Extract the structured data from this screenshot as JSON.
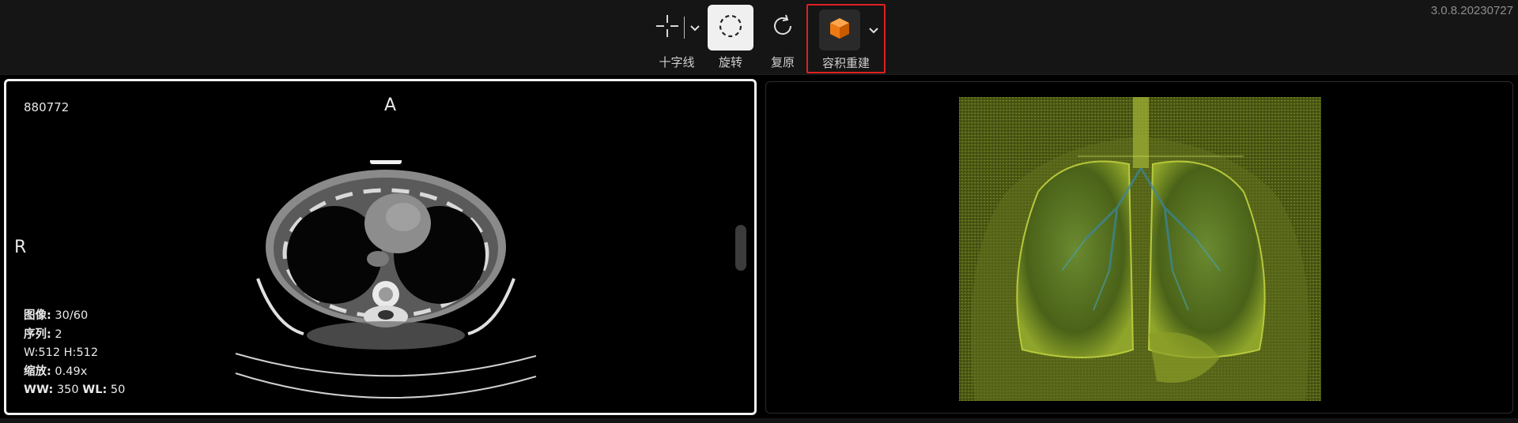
{
  "app": {
    "version": "3.0.8.20230727"
  },
  "toolbar": {
    "tools": [
      {
        "id": "crosshair",
        "label": "十字线",
        "icon": "crosshair-icon"
      },
      {
        "id": "rotate",
        "label": "旋转",
        "icon": "rotate-icon",
        "active": true
      },
      {
        "id": "reset",
        "label": "复原",
        "icon": "reset-icon"
      },
      {
        "id": "volume",
        "label": "容积重建",
        "icon": "cube-icon",
        "highlighted": true
      }
    ]
  },
  "viewport_left": {
    "patient_id": "880772",
    "orientation_top": "A",
    "orientation_left": "R",
    "info": {
      "image_label": "图像:",
      "image_value": " 30/60",
      "series_label": "序列:",
      "series_value": " 2",
      "size_value": "W:512 H:512",
      "zoom_label": "缩放:",
      "zoom_value": " 0.49x",
      "ww_label": "WW:",
      "ww_value": " 350 ",
      "wl_label": "WL:",
      "wl_value": " 50"
    }
  },
  "viewport_right": {
    "content": "volume-rendering"
  },
  "colors": {
    "accent_highlight": "#e02020",
    "cube_orange": "#f07a12",
    "toolbar_bg": "#151515"
  }
}
